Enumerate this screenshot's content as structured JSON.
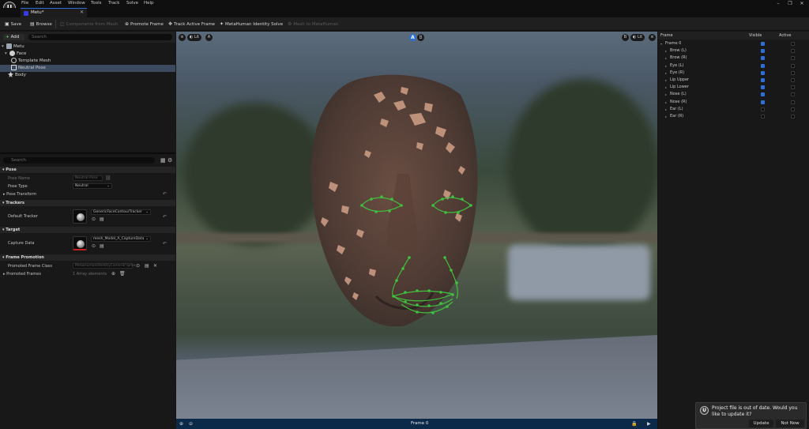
{
  "app": {
    "logo_letter": "U"
  },
  "menu": {
    "items": [
      "File",
      "Edit",
      "Asset",
      "Window",
      "Tools",
      "Track",
      "Solve",
      "Help"
    ]
  },
  "window_controls": {
    "minimize": "–",
    "restore": "❐",
    "close": "✕"
  },
  "tab": {
    "title": "Metu*",
    "close": "✕"
  },
  "toolbar": {
    "save": "Save",
    "browse": "Browse",
    "components_from_mesh": "Components from Mesh",
    "promote_frame": "Promote Frame",
    "track_active_frame": "Track Active Frame",
    "identity_solve": "MetaHuman Identity Solve",
    "mesh_to_metahuman": "Mesh to MetaHuman"
  },
  "outliner": {
    "add_label": "Add",
    "search_placeholder": "Search",
    "tree": [
      {
        "label": "Metu",
        "indent": 0,
        "selected": false,
        "icon": "identity-icon"
      },
      {
        "label": "Face",
        "indent": 1,
        "selected": false,
        "icon": "face-icon"
      },
      {
        "label": "Template Mesh",
        "indent": 2,
        "selected": false,
        "icon": "mesh-icon"
      },
      {
        "label": "Neutral Pose",
        "indent": 2,
        "selected": true,
        "icon": "pose-icon"
      },
      {
        "label": "Body",
        "indent": 1,
        "selected": false,
        "icon": "body-icon"
      }
    ]
  },
  "details": {
    "search_placeholder": "Search",
    "sections": {
      "pose": "Pose",
      "trackers": "Trackers",
      "target": "Target",
      "frame_promotion": "Frame Promotion"
    },
    "pose_name_label": "Pose Name",
    "pose_name_value": "Neutral Pose",
    "pose_type_label": "Pose Type",
    "pose_type_value": "Neutral",
    "pose_transform_label": "Pose Transform",
    "default_tracker_label": "Default Tracker",
    "default_tracker_value": "GenericFaceContourTracker",
    "capture_data_label": "Capture Data",
    "capture_data_value": "mesh_Model_A_CaptureData",
    "promoted_frame_class_label": "Promoted Frame Class",
    "promoted_frame_class_value": "MetaHumanIdentityCameraFrame",
    "promoted_frames_label": "Promoted Frames",
    "promoted_frames_value": "1 Array elements"
  },
  "viewport": {
    "lit_left": "Lit",
    "lit_right": "Lit",
    "toggle_a": "A",
    "toggle_b": "B",
    "letter_left": "A",
    "letter_right": "B"
  },
  "timeline": {
    "frame_label": "Frame 0"
  },
  "frames_panel": {
    "col_frame": "Frame",
    "col_visible": "Visible",
    "col_active": "Active",
    "rows": [
      {
        "label": "Frame 0",
        "root": true,
        "visible": true,
        "active": false
      },
      {
        "label": "Brow (L)",
        "root": false,
        "visible": true,
        "active": false
      },
      {
        "label": "Brow (R)",
        "root": false,
        "visible": true,
        "active": false
      },
      {
        "label": "Eye (L)",
        "root": false,
        "visible": true,
        "active": false
      },
      {
        "label": "Eye (R)",
        "root": false,
        "visible": true,
        "active": false
      },
      {
        "label": "Lip Upper",
        "root": false,
        "visible": true,
        "active": false
      },
      {
        "label": "Lip Lower",
        "root": false,
        "visible": true,
        "active": false
      },
      {
        "label": "Nose (L)",
        "root": false,
        "visible": true,
        "active": false
      },
      {
        "label": "Nose (R)",
        "root": false,
        "visible": true,
        "active": false
      },
      {
        "label": "Ear (L)",
        "root": false,
        "visible": false,
        "active": false
      },
      {
        "label": "Ear (R)",
        "root": false,
        "visible": false,
        "active": false
      }
    ]
  },
  "notification": {
    "text": "Project file is out of date. Would you like to update it?",
    "update": "Update",
    "not_now": "Not Now"
  },
  "colors": {
    "accent": "#2d6fd8",
    "landmark_green": "#3fc23f",
    "selection": "#3b4a5e",
    "timeline": "#0b2a4a"
  }
}
